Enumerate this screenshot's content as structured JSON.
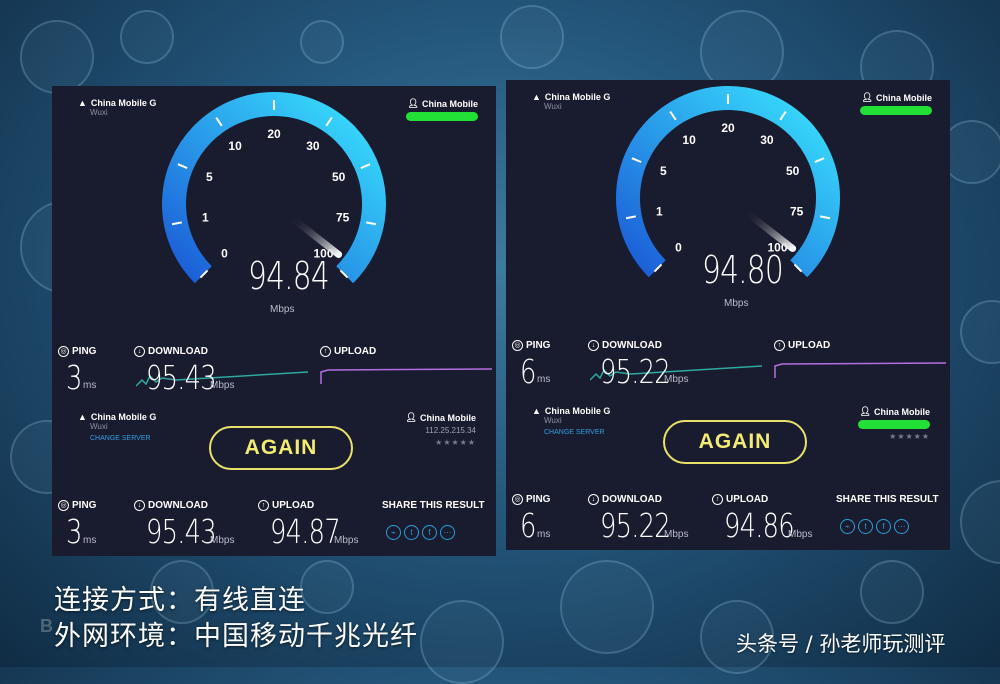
{
  "colors": {
    "panel_bg": "#191b2e",
    "accent_yellow": "#f3ec72",
    "green_bar": "#22e035",
    "download_line": "#2ea9a0",
    "upload_line": "#b56ee0",
    "gauge_start": "#1b5bd6",
    "gauge_end": "#39e3ff"
  },
  "gauge_scale": [
    "0",
    "1",
    "5",
    "10",
    "20",
    "30",
    "50",
    "75",
    "100"
  ],
  "unit_mbps": "Mbps",
  "unit_ms": "ms",
  "labels": {
    "ping": "PING",
    "download": "DOWNLOAD",
    "upload": "UPLOAD",
    "again": "AGAIN",
    "share": "SHARE THIS RESULT",
    "change_server": "CHANGE SERVER"
  },
  "panels": [
    {
      "isp": "China Mobile G",
      "city": "Wuxi",
      "provider": "China Mobile",
      "server_ip": "112.25.215.34",
      "stars": "★★★★★",
      "gauge_value": "94.84",
      "needle_level": 94.84,
      "ping": "3",
      "download": "95.43",
      "upload": "94.87"
    },
    {
      "isp": "China Mobile G",
      "city": "Wuxi",
      "provider": "China Mobile",
      "server_ip": "",
      "stars": "★★★★★",
      "gauge_value": "94.80",
      "needle_level": 94.8,
      "ping": "6",
      "download": "95.22",
      "upload": "94.86"
    }
  ],
  "share_icons": [
    "link-icon",
    "twitter-icon",
    "facebook-icon",
    "more-icon"
  ],
  "caption": {
    "line1": "连接方式：有线直连",
    "line2": "外网环境：中国移动千兆光纤"
  },
  "watermark": "头条号 / 孙老师玩测评",
  "ghost_text": "B"
}
